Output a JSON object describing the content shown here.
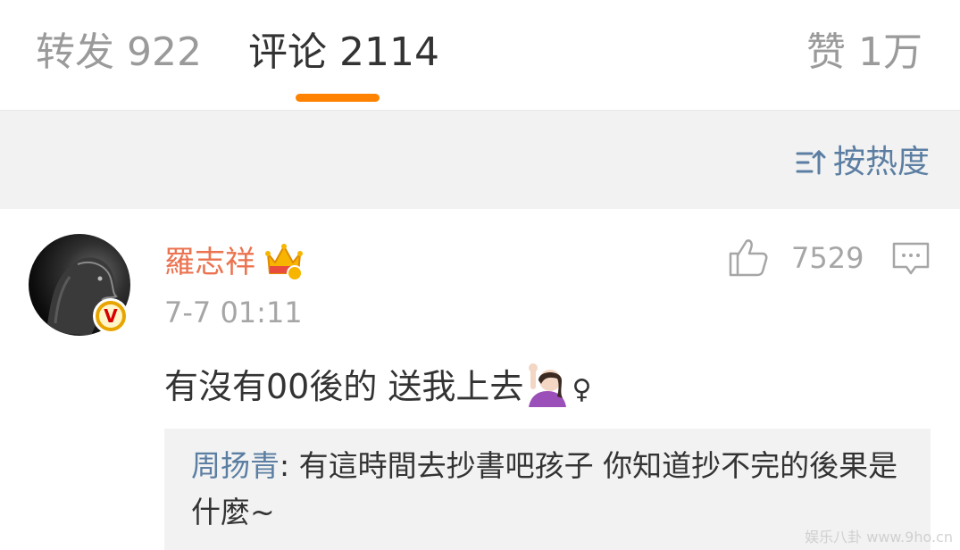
{
  "tabs": {
    "repost": "转发 922",
    "comments": "评论 2114",
    "likes": "赞 1万",
    "active_color": "#ff8200"
  },
  "sort": {
    "label": "按热度",
    "icon": "sort-up-icon"
  },
  "comment": {
    "username": "羅志祥",
    "username_color": "#eb7350",
    "badge_icon": "crown-icon",
    "verified_icon": "verified-v-icon",
    "verified_text": "V",
    "timestamp": "7-7 01:11",
    "like_count": "7529",
    "like_icon": "thumbs-up-icon",
    "reply_icon": "comment-bubble-icon",
    "text_main": "有沒有00後的 送我上去",
    "emoji": "person-raising-hand-emoji",
    "text_suffix": "♀",
    "reply": {
      "author": "周扬青",
      "separator": ":",
      "text": " 有這時間去抄書吧孩子 你知道抄不完的後果是什麼~"
    }
  },
  "watermark": "娱乐八卦 www.9ho.cn"
}
